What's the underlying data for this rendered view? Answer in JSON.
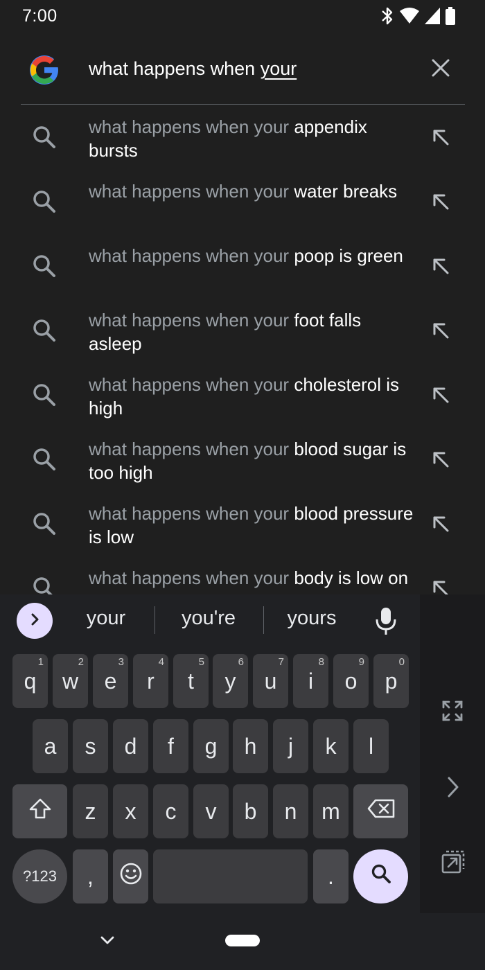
{
  "status": {
    "time": "7:00"
  },
  "search": {
    "typed_prefix": "what happens when ",
    "composing_word": "your"
  },
  "suggestions": [
    {
      "query": "what happens when your ",
      "completion": "appendix bursts"
    },
    {
      "query": "what happens when your ",
      "completion": "water breaks"
    },
    {
      "query": "what happens when your ",
      "completion": "poop is green"
    },
    {
      "query": "what happens when your ",
      "completion": "foot falls asleep"
    },
    {
      "query": "what happens when your ",
      "completion": "cholesterol is high"
    },
    {
      "query": "what happens when your ",
      "completion": "blood sugar is too high"
    },
    {
      "query": "what happens when your ",
      "completion": "blood pressure is low"
    },
    {
      "query": "what happens when your ",
      "completion": "body is low on sodium"
    }
  ],
  "keyboard": {
    "strip": [
      "your",
      "you're",
      "yours"
    ],
    "row1": [
      {
        "k": "q",
        "h": "1"
      },
      {
        "k": "w",
        "h": "2"
      },
      {
        "k": "e",
        "h": "3"
      },
      {
        "k": "r",
        "h": "4"
      },
      {
        "k": "t",
        "h": "5"
      },
      {
        "k": "y",
        "h": "6"
      },
      {
        "k": "u",
        "h": "7"
      },
      {
        "k": "i",
        "h": "8"
      },
      {
        "k": "o",
        "h": "9"
      },
      {
        "k": "p",
        "h": "0"
      }
    ],
    "row2": [
      "a",
      "s",
      "d",
      "f",
      "g",
      "h",
      "j",
      "k",
      "l"
    ],
    "row3": [
      "z",
      "x",
      "c",
      "v",
      "b",
      "n",
      "m"
    ],
    "symbols_label": "?123",
    "comma": ",",
    "period": "."
  },
  "colors": {
    "accent": "#e4dcff",
    "key": "#3c3c3f",
    "key_fn": "#49494d",
    "bg": "#1f1f1f"
  }
}
